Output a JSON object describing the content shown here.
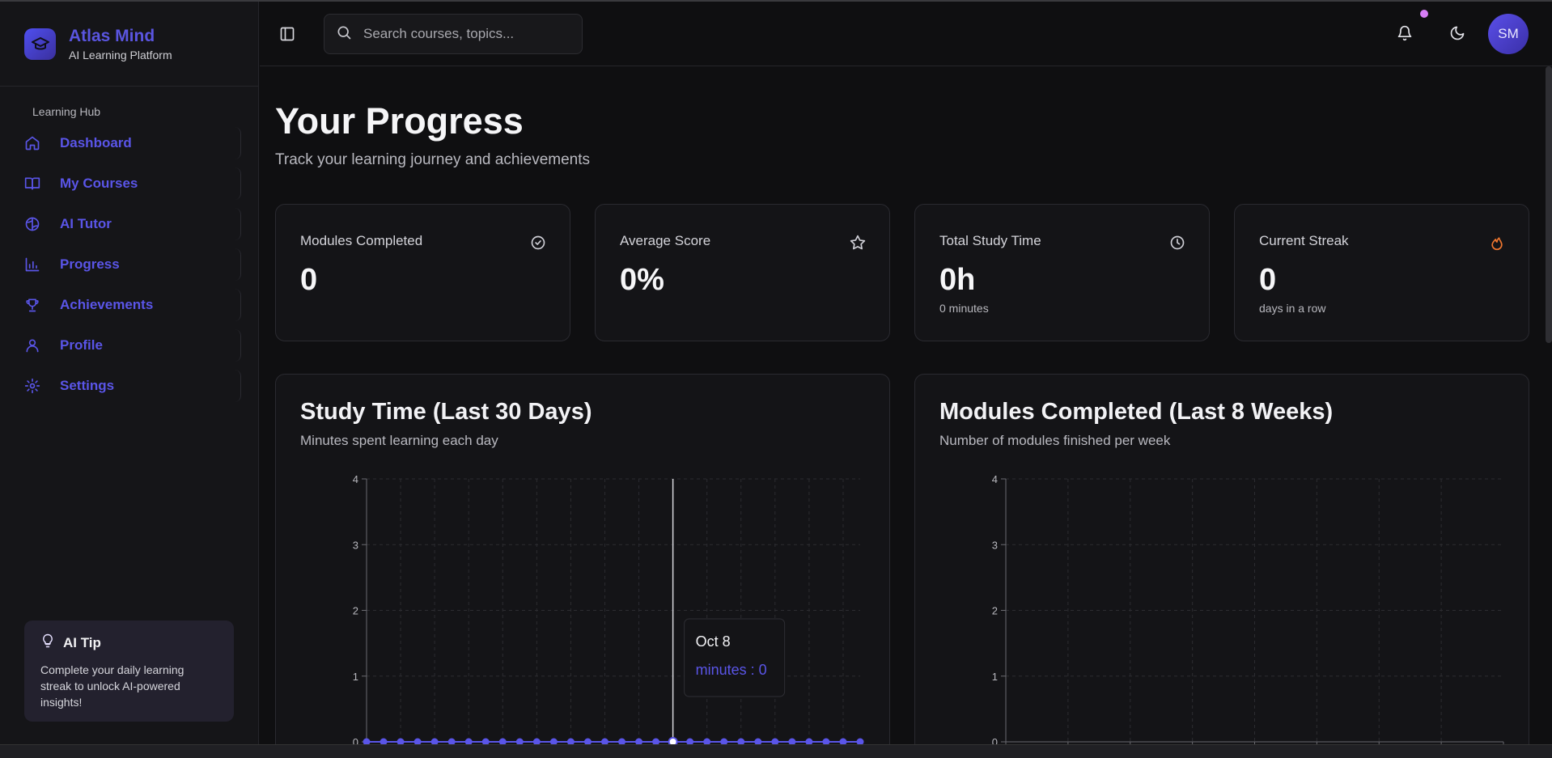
{
  "brand": {
    "title": "Atlas Mind",
    "subtitle": "AI Learning Platform"
  },
  "sidebar": {
    "section": "Learning Hub",
    "items": [
      {
        "label": "Dashboard",
        "icon": "home-icon"
      },
      {
        "label": "My Courses",
        "icon": "book-icon"
      },
      {
        "label": "AI Tutor",
        "icon": "brain-icon"
      },
      {
        "label": "Progress",
        "icon": "bar-chart-icon"
      },
      {
        "label": "Achievements",
        "icon": "trophy-icon"
      },
      {
        "label": "Profile",
        "icon": "user-icon"
      },
      {
        "label": "Settings",
        "icon": "gear-icon"
      }
    ],
    "tip": {
      "title": "AI Tip",
      "body": "Complete your daily learning streak to unlock AI-powered insights!"
    }
  },
  "header": {
    "search_placeholder": "Search courses, topics...",
    "avatar_initials": "SM"
  },
  "page": {
    "title": "Your Progress",
    "subtitle": "Track your learning journey and achievements"
  },
  "stats": [
    {
      "label": "Modules Completed",
      "value": "0",
      "note": "",
      "icon": "check-circle-icon"
    },
    {
      "label": "Average Score",
      "value": "0%",
      "note": "",
      "icon": "star-icon"
    },
    {
      "label": "Total Study Time",
      "value": "0h",
      "note": "0 minutes",
      "icon": "clock-icon"
    },
    {
      "label": "Current Streak",
      "value": "0",
      "note": "days in a row",
      "icon": "flame-icon"
    }
  ],
  "colors": {
    "accent": "#5a55e8",
    "flame": "#f0772f",
    "notification": "#d67ef5"
  },
  "charts": {
    "study": {
      "title": "Study Time (Last 30 Days)",
      "subtitle": "Minutes spent learning each day"
    },
    "modules": {
      "title": "Modules Completed (Last 8 Weeks)",
      "subtitle": "Number of modules finished per week"
    }
  },
  "chart_data": [
    {
      "type": "line",
      "title": "Study Time (Last 30 Days)",
      "xlabel": "",
      "ylabel": "",
      "ylim": [
        0,
        4
      ],
      "yticks": [
        0,
        1,
        2,
        3,
        4
      ],
      "grid": true,
      "point_count": 30,
      "values": [
        0,
        0,
        0,
        0,
        0,
        0,
        0,
        0,
        0,
        0,
        0,
        0,
        0,
        0,
        0,
        0,
        0,
        0,
        0,
        0,
        0,
        0,
        0,
        0,
        0,
        0,
        0,
        0,
        0,
        0
      ],
      "series": [
        {
          "name": "minutes",
          "values": [
            0,
            0,
            0,
            0,
            0,
            0,
            0,
            0,
            0,
            0,
            0,
            0,
            0,
            0,
            0,
            0,
            0,
            0,
            0,
            0,
            0,
            0,
            0,
            0,
            0,
            0,
            0,
            0,
            0,
            0
          ]
        }
      ],
      "tooltip": {
        "label": "Oct 8",
        "text": "minutes : 0",
        "index": 18
      }
    },
    {
      "type": "bar",
      "title": "Modules Completed (Last 8 Weeks)",
      "xlabel": "",
      "ylabel": "",
      "ylim": [
        0,
        4
      ],
      "yticks": [
        0,
        1,
        2,
        3,
        4
      ],
      "grid": true,
      "values": [
        0,
        0,
        0,
        0,
        0,
        0,
        0,
        0
      ]
    }
  ]
}
